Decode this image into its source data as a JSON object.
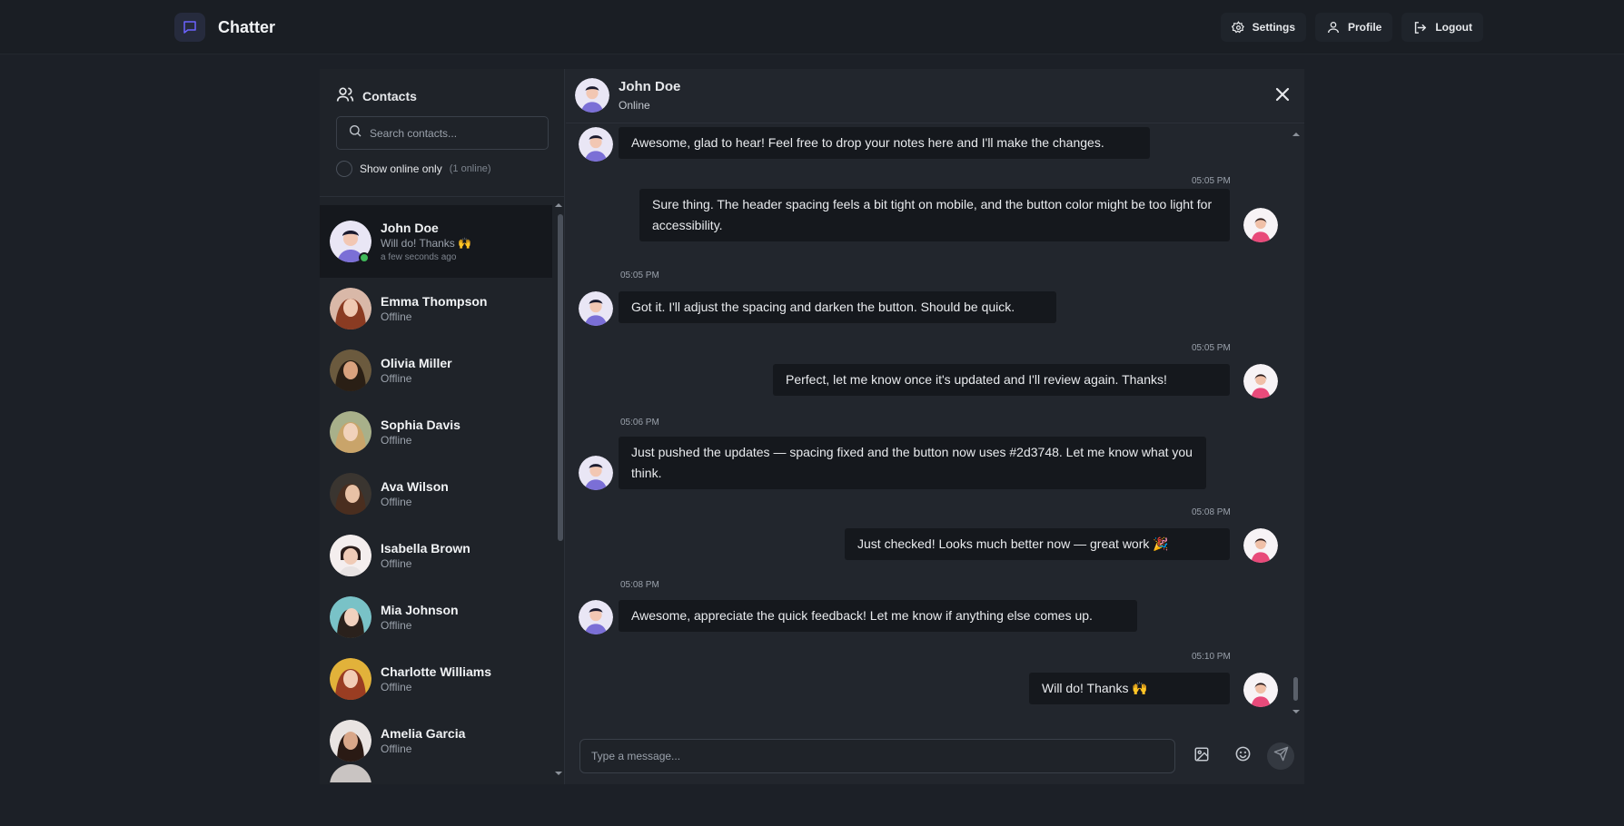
{
  "app": {
    "title": "Chatter"
  },
  "nav": {
    "settings_label": "Settings",
    "profile_label": "Profile",
    "logout_label": "Logout"
  },
  "sidebar": {
    "title": "Contacts",
    "search_placeholder": "Search contacts...",
    "online_only_label": "Show online only",
    "online_count": "(1 online)",
    "contacts": [
      {
        "name": "John Doe",
        "sub": "Will do! Thanks 🙌",
        "time": "a few seconds ago",
        "active": true,
        "online": true
      },
      {
        "name": "Emma Thompson",
        "sub": "Offline"
      },
      {
        "name": "Olivia Miller",
        "sub": "Offline"
      },
      {
        "name": "Sophia Davis",
        "sub": "Offline"
      },
      {
        "name": "Ava Wilson",
        "sub": "Offline"
      },
      {
        "name": "Isabella Brown",
        "sub": "Offline"
      },
      {
        "name": "Mia Johnson",
        "sub": "Offline"
      },
      {
        "name": "Charlotte Williams",
        "sub": "Offline"
      },
      {
        "name": "Amelia Garcia",
        "sub": "Offline"
      }
    ]
  },
  "chat": {
    "contact_name": "John Doe",
    "contact_status": "Online",
    "messages": [
      {
        "from": "them",
        "text": "Awesome, glad to hear! Feel free to drop your notes here and I'll make the changes.",
        "time": ""
      },
      {
        "from": "me",
        "text": "Sure thing. The header spacing feels a bit tight on mobile, and the button color might be too light for accessibility.",
        "time": "05:05 PM"
      },
      {
        "from": "them",
        "text": "Got it. I'll adjust the spacing and darken the button. Should be quick.",
        "time": "05:05 PM"
      },
      {
        "from": "me",
        "text": "Perfect, let me know once it's updated and I'll review again. Thanks!",
        "time": "05:05 PM"
      },
      {
        "from": "them",
        "text": "Just pushed the updates — spacing fixed and the button now uses #2d3748. Let me know what you think.",
        "time": "05:06 PM"
      },
      {
        "from": "me",
        "text": "Just checked! Looks much better now — great work 🎉",
        "time": "05:08 PM"
      },
      {
        "from": "them",
        "text": "Awesome, appreciate the quick feedback! Let me know if anything else comes up.",
        "time": "05:08 PM"
      },
      {
        "from": "me",
        "text": "Will do! Thanks 🙌",
        "time": "05:10 PM"
      }
    ],
    "input_placeholder": "Type a message..."
  },
  "icons": {
    "brand": "chat-bubble-icon",
    "settings": "gear-icon",
    "profile": "user-icon",
    "logout": "logout-icon",
    "contacts": "users-icon",
    "search": "search-icon",
    "close": "close-icon",
    "image": "image-icon",
    "emoji": "emoji-icon",
    "send": "send-icon"
  },
  "colors": {
    "background": "#1c2027",
    "accent": "#6b63ff",
    "online": "#3fb95a",
    "bubble": "#15181d"
  }
}
